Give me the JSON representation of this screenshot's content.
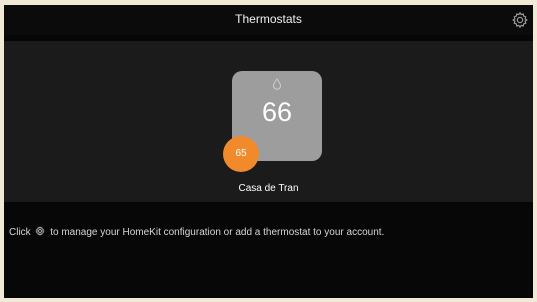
{
  "header": {
    "title": "Thermostats",
    "settings_icon": "gear-icon"
  },
  "thermostat": {
    "name": "Casa de Tran",
    "current_temperature": "66",
    "setpoint": "65",
    "mode_icon": "water-drop-icon",
    "tile_color": "#9d9d9d",
    "setpoint_color": "#f08a2a"
  },
  "hint": {
    "before_icon": "Click",
    "icon": "gear-icon",
    "after_icon": "to manage your HomeKit configuration or add a thermostat to your account."
  },
  "colors": {
    "background": "#070707",
    "panel": "#1b1b1b",
    "accent": "#f08a2a"
  }
}
